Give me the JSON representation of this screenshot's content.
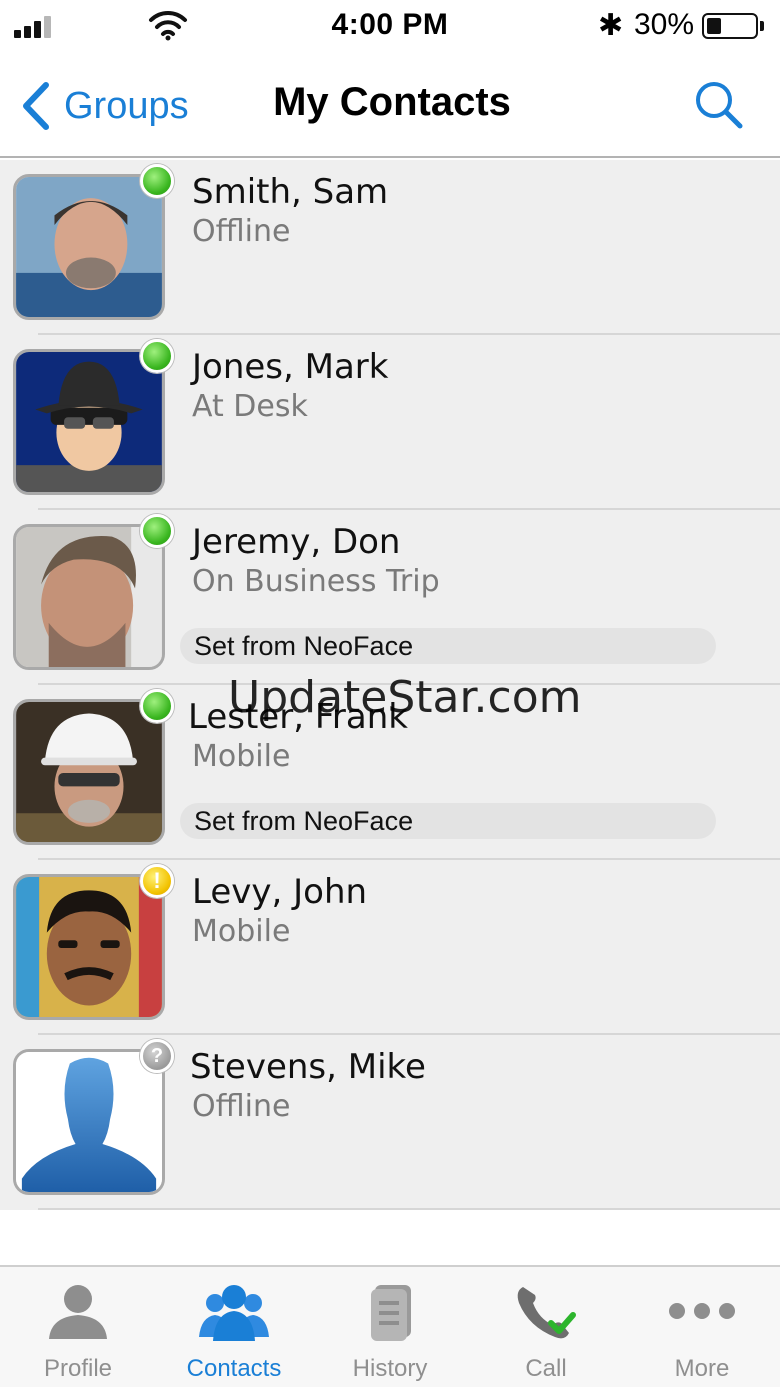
{
  "status_bar": {
    "time": "4:00 PM",
    "battery_text": "30%",
    "battery_level": 0.3,
    "bluetooth_glyph": "✱"
  },
  "nav": {
    "back_label": "Groups",
    "title": "My Contacts",
    "icons": {
      "back": "chevron-left-icon",
      "search": "search-icon"
    }
  },
  "contacts": [
    {
      "name": "Smith, Sam",
      "status": "Offline",
      "presence": "green",
      "note": ""
    },
    {
      "name": "Jones, Mark",
      "status": "At Desk",
      "presence": "green",
      "note": ""
    },
    {
      "name": "Jeremy, Don",
      "status": "On Business Trip",
      "presence": "green",
      "note": "Set from NeoFace"
    },
    {
      "name": "Lester, Frank",
      "status": "Mobile",
      "presence": "green",
      "note": "Set from NeoFace"
    },
    {
      "name": "Levy, John",
      "status": "Mobile",
      "presence": "yellow",
      "note": ""
    },
    {
      "name": "Stevens, Mike",
      "status": "Offline",
      "presence": "gray",
      "note": ""
    }
  ],
  "watermark": "UpdateStar.com",
  "tabs": [
    {
      "label": "Profile",
      "icon": "profile-icon",
      "active": false
    },
    {
      "label": "Contacts",
      "icon": "contacts-icon",
      "active": true
    },
    {
      "label": "History",
      "icon": "history-icon",
      "active": false
    },
    {
      "label": "Call",
      "icon": "call-icon",
      "active": false
    },
    {
      "label": "More",
      "icon": "more-icon",
      "active": false
    }
  ],
  "colors": {
    "accent": "#1a7fd6",
    "presence_green": "#38b51e",
    "presence_yellow": "#f2c200",
    "presence_gray": "#9a9a9a",
    "list_background": "#efefef"
  }
}
